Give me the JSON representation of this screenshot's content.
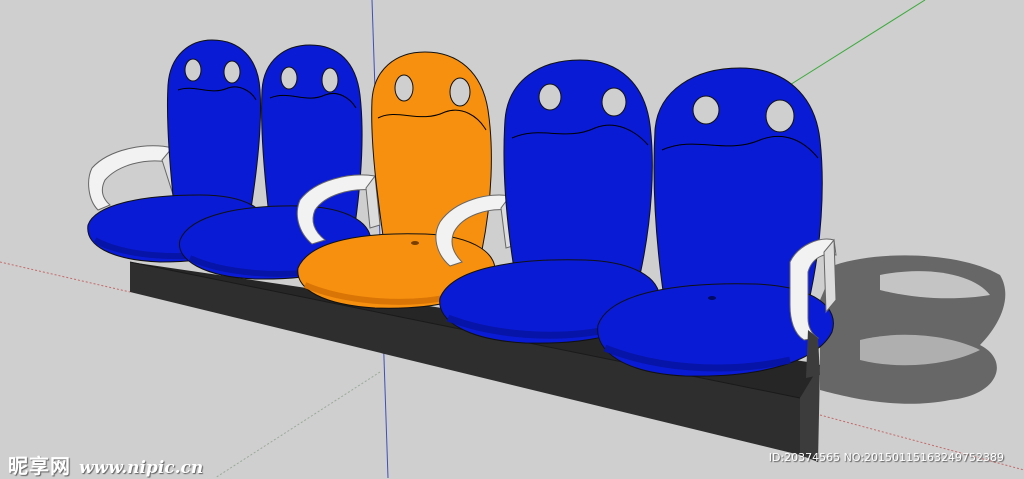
{
  "scene": {
    "subject": "row of five stadium seats on a bench base (3D model render)",
    "seat_colors": {
      "blue": "#0a1bd6",
      "blue_shade": "#0714a8",
      "orange": "#f7900e",
      "orange_shade": "#d97406",
      "armrest": "#f2f2f2",
      "base": "#2e2e2e",
      "background": "#cfcfcf"
    }
  },
  "watermark": {
    "brand": "昵享网",
    "url": "www.nipic.cn",
    "id_line": "ID:20374565 NO:20150115163249752389"
  }
}
